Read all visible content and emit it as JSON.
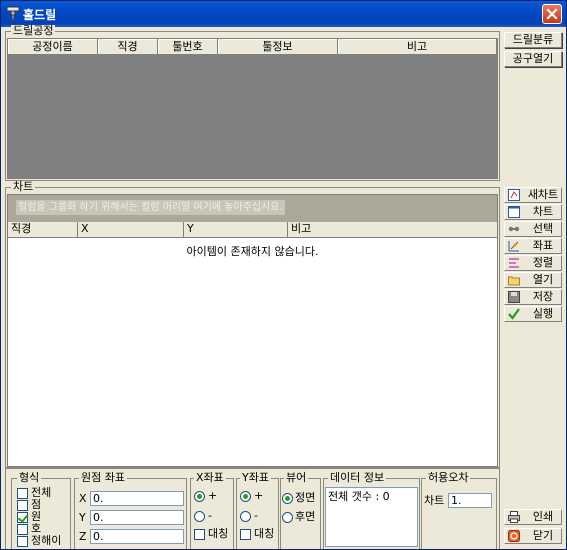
{
  "window": {
    "title": "홀드릴",
    "close_label": "X"
  },
  "drill_process": {
    "group_label": "드릴공정",
    "columns": [
      "공정이름",
      "직경",
      "툴번호",
      "툴정보",
      "비고"
    ]
  },
  "right_top_buttons": {
    "classify": "드릴분류",
    "open_tool": "공구열기"
  },
  "chart": {
    "group_label": "차트",
    "group_hint": "컬럼을 그룹화 하기 위해서는 컬럼 머리말 여기에 놓아주십시요.",
    "columns": [
      "직경",
      "X",
      "Y",
      "비고"
    ],
    "empty_message": "아이템이 존재하지 않습니다."
  },
  "tools": [
    "새차트",
    "차트",
    "선택",
    "좌표",
    "정렬",
    "열기",
    "저장",
    "실행"
  ],
  "bottom_buttons": {
    "print": "인쇄",
    "close": "닫기"
  },
  "shape": {
    "label": "형식",
    "items": [
      {
        "label": "전체",
        "checked": false
      },
      {
        "label": "점",
        "checked": false
      },
      {
        "label": "원",
        "checked": true
      },
      {
        "label": "호",
        "checked": false
      },
      {
        "label": "정해이",
        "checked": false
      }
    ]
  },
  "origin": {
    "label": "원점 좌표",
    "x_label": "X",
    "x_value": "0.",
    "y_label": "Y",
    "y_value": "0.",
    "z_label": "Z",
    "z_value": "0."
  },
  "x_coord": {
    "label": "X좌표",
    "plus": "+",
    "minus": "-",
    "symmetric": "대칭"
  },
  "y_coord": {
    "label": "Y좌표",
    "plus": "+",
    "minus": "-",
    "symmetric": "대칭"
  },
  "view": {
    "label": "뷰어",
    "front": "정면",
    "back": "후면"
  },
  "data_info": {
    "label": "데이터 정보",
    "total": "전체 갯수 : 0"
  },
  "tolerance": {
    "label": "허용오차",
    "chart_label": "차트",
    "chart_value": "1."
  }
}
